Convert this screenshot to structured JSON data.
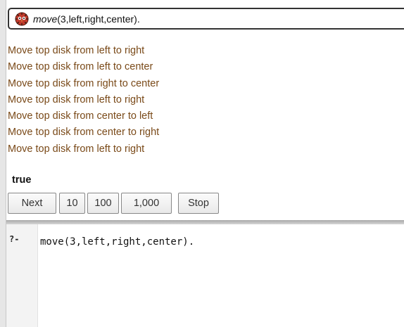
{
  "query": {
    "predicate": "move",
    "args": "(3,left,right,center)."
  },
  "answers": [
    "Move top disk from left to right",
    "Move top disk from left to center",
    "Move top disk from right to center",
    "Move top disk from left to right",
    "Move top disk from center to left",
    "Move top disk from center to right",
    "Move top disk from left to right"
  ],
  "result": "true",
  "buttons": {
    "next": "Next",
    "ten": "10",
    "hundred": "100",
    "thousand": "1,000",
    "stop": "Stop"
  },
  "editor": {
    "prompt": "?-",
    "text": "move(3,left,right,center)."
  },
  "icons": {
    "query": "swi-prolog-owl-icon"
  },
  "colors": {
    "answer_text": "#7a4a19"
  }
}
